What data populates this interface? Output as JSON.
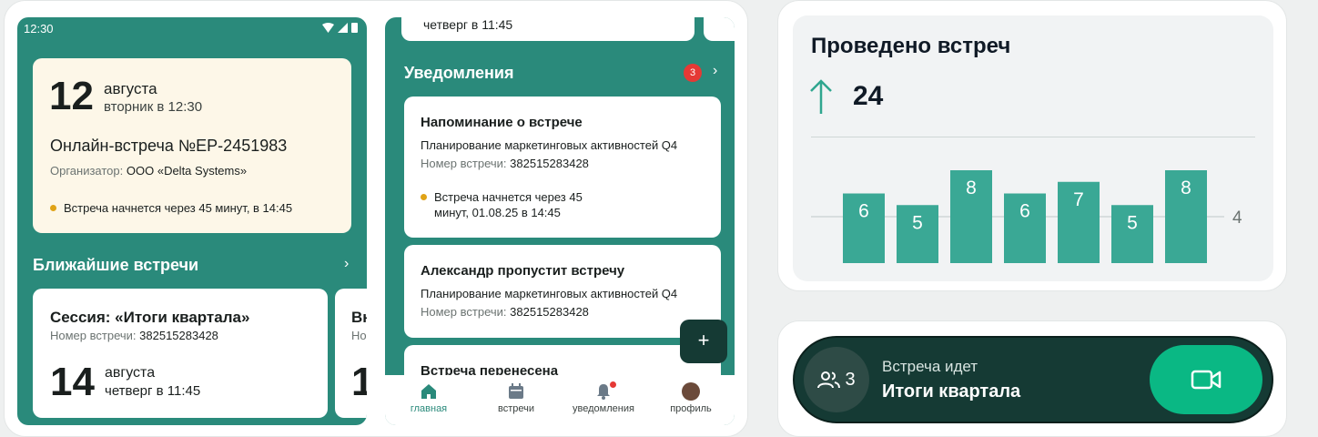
{
  "phone1": {
    "status_time": "12:30",
    "next_meeting": {
      "day": "12",
      "month": "августа",
      "weekday_time": "вторник в 12:30",
      "title": "Онлайн-встреча №EP-2451983",
      "organizer_label": "Организатор:",
      "organizer": "ООО «Delta Systems»",
      "status": "Встреча начнется через 45 минут, в 14:45",
      "status_color": "#e0a316"
    },
    "upcoming_title": "Ближайшие встречи",
    "upcoming": [
      {
        "title": "Сессия: «Итоги квартала»",
        "number_label": "Номер встречи:",
        "number": "382515283428",
        "day": "14",
        "month": "августа",
        "weekday_time": "четверг в 11:45"
      },
      {
        "title": "Вн",
        "number_label": "Но",
        "day": "1"
      }
    ]
  },
  "phone2": {
    "top_peek_text": "четверг в 11:45",
    "notifications_title": "Уведомления",
    "notifications_badge": "3",
    "notifications": [
      {
        "title": "Напоминание о встрече",
        "subtitle": "Планирование маркетинговых активностей Q4",
        "number_label": "Номер встречи:",
        "number": "382515283428",
        "status": "Встреча начнется через 45 минут, 01.08.25 в 14:45"
      },
      {
        "title": "Александр пропустит встречу",
        "subtitle": "Планирование маркетинговых активностей Q4",
        "number_label": "Номер встречи:",
        "number": "382515283428"
      },
      {
        "title": "Встреча перенесена"
      }
    ],
    "fab_label": "+",
    "tabs": [
      {
        "label": "главная",
        "icon": "home-icon",
        "active": true
      },
      {
        "label": "встречи",
        "icon": "calendar-icon",
        "active": false
      },
      {
        "label": "уведомления",
        "icon": "bell-icon",
        "active": false
      },
      {
        "label": "профиль",
        "icon": "avatar-icon",
        "active": false
      }
    ]
  },
  "stats": {
    "title": "Проведено встреч",
    "value": "24",
    "trend": "up",
    "accent": "#2fa68f",
    "chart_data": {
      "type": "bar",
      "values": [
        6,
        5,
        8,
        6,
        7,
        5,
        8
      ],
      "reference_line": 4,
      "reference_label": "4",
      "ylim": [
        0,
        10
      ],
      "bar_color": "#3aa895"
    }
  },
  "call": {
    "participants": "3",
    "label": "Встреча идет",
    "title": "Итоги квартала",
    "join_color": "#0ab884"
  }
}
